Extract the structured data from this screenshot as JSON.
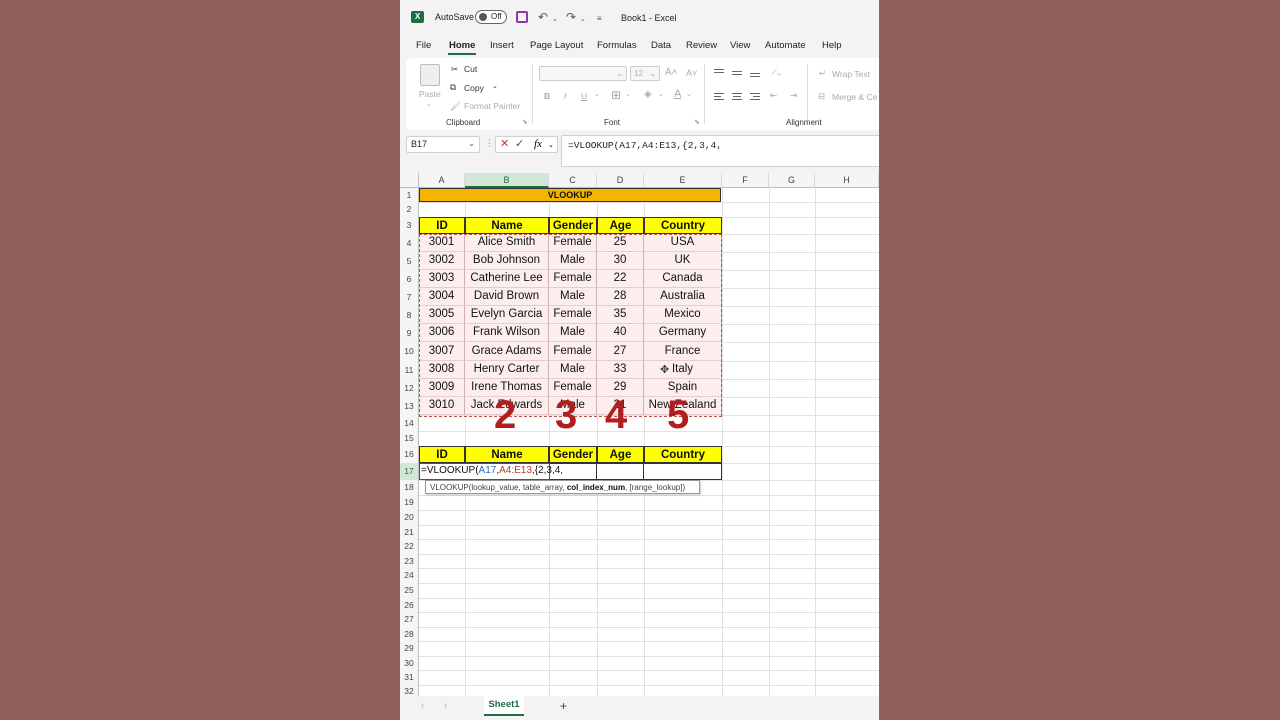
{
  "titlebar": {
    "autosave": "AutoSave",
    "toggle": "Off",
    "doc_title": "Book1  -  Excel"
  },
  "menu": [
    "File",
    "Home",
    "Insert",
    "Page Layout",
    "Formulas",
    "Data",
    "Review",
    "View",
    "Automate",
    "Help"
  ],
  "ribbon": {
    "paste": "Paste",
    "cut": "Cut",
    "copy": "Copy",
    "format_painter": "Format Painter",
    "clipboard": "Clipboard",
    "font_size": "12",
    "font": "Font",
    "alignment": "Alignment",
    "wrap_text": "Wrap Text",
    "merge_center": "Merge & Ce",
    "bold": "B",
    "italic": "I",
    "underline": "U"
  },
  "formula_bar": {
    "name_box": "B17",
    "fx": "fx",
    "formula": "=VLOOKUP(A17,A4:E13,{2,3,4,"
  },
  "columns": [
    "A",
    "B",
    "C",
    "D",
    "E",
    "F",
    "G",
    "H"
  ],
  "rows": [
    "1",
    "2",
    "3",
    "4",
    "5",
    "6",
    "7",
    "8",
    "9",
    "10",
    "11",
    "12",
    "13",
    "14",
    "15",
    "16",
    "17",
    "18",
    "19",
    "20",
    "21",
    "22",
    "23",
    "24",
    "25",
    "26",
    "27",
    "28",
    "29",
    "30",
    "31",
    "32"
  ],
  "sheet": {
    "title": "VLOOKUP",
    "headers": [
      "ID",
      "Name",
      "Gender",
      "Age",
      "Country"
    ],
    "data": [
      [
        "3001",
        "Alice Smith",
        "Female",
        "25",
        "USA"
      ],
      [
        "3002",
        "Bob Johnson",
        "Male",
        "30",
        "UK"
      ],
      [
        "3003",
        "Catherine Lee",
        "Female",
        "22",
        "Canada"
      ],
      [
        "3004",
        "David Brown",
        "Male",
        "28",
        "Australia"
      ],
      [
        "3005",
        "Evelyn Garcia",
        "Female",
        "35",
        "Mexico"
      ],
      [
        "3006",
        "Frank Wilson",
        "Male",
        "40",
        "Germany"
      ],
      [
        "3007",
        "Grace Adams",
        "Female",
        "27",
        "France"
      ],
      [
        "3008",
        "Henry Carter",
        "Male",
        "33",
        "Italy"
      ],
      [
        "3009",
        "Irene Thomas",
        "Female",
        "29",
        "Spain"
      ],
      [
        "3010",
        "Jack Edwards",
        "Male",
        "31",
        "New Zealand"
      ]
    ],
    "lookup_headers": [
      "ID",
      "Name",
      "Gender",
      "Age",
      "Country"
    ],
    "annotations": [
      "2",
      "3",
      "4",
      "5"
    ],
    "edit": {
      "fn": "=VLOOKUP(",
      "ref1": "A17",
      "sep1": ",",
      "ref2": "A4:E13",
      "rest": ",{2,3,4,"
    },
    "tooltip": {
      "pre": "VLOOKUP(lookup_value, table_array, ",
      "bold": "col_index_num",
      "post": ", [range_lookup])"
    }
  },
  "sheetbar": {
    "tab": "Sheet1",
    "add": "+"
  }
}
